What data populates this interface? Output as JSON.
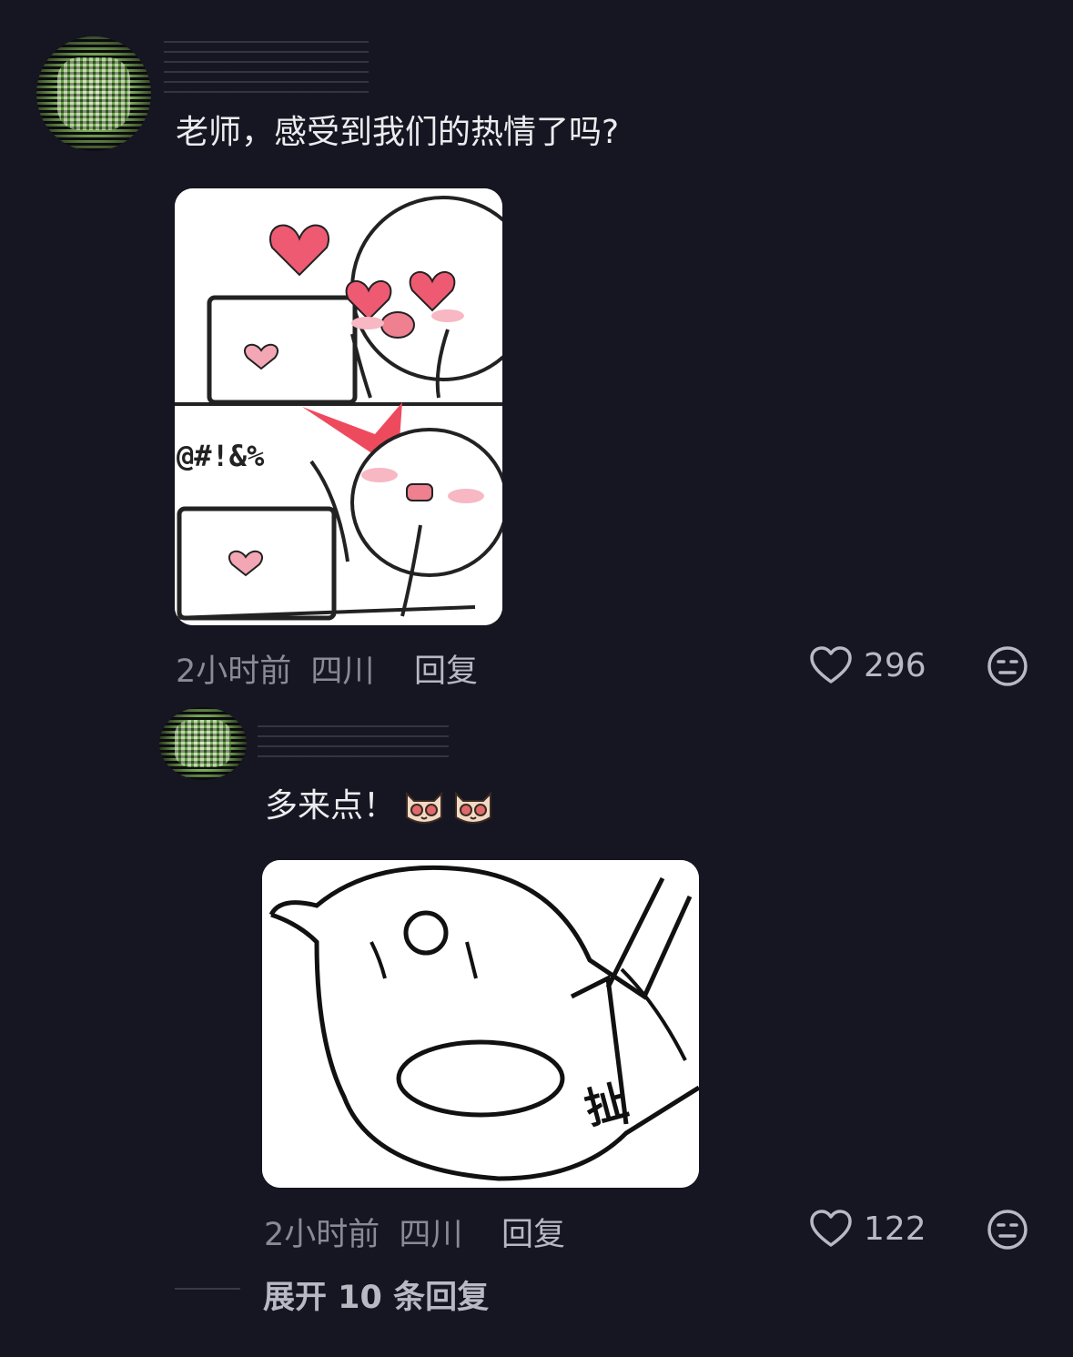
{
  "comments": [
    {
      "text": "老师，感受到我们的热情了吗?",
      "sticker_icon": "heart-eyes-laptop-meme",
      "time": "2小时前",
      "location": "四川",
      "reply_label": "回复",
      "likes": "296",
      "like_icon": "heart-outline-icon",
      "menu_icon": "face-emoji-icon"
    },
    {
      "text": "多来点！",
      "emoji_icons": [
        "cat-dizzy-emoji",
        "cat-dizzy-emoji"
      ],
      "sticker_icon": "cat-pulling-meme",
      "sticker_caption": "扯",
      "time": "2小时前",
      "location": "四川",
      "reply_label": "回复",
      "likes": "122",
      "like_icon": "heart-outline-icon",
      "menu_icon": "face-emoji-icon"
    }
  ],
  "expand": {
    "label": "展开 10 条回复"
  },
  "sticker1": {
    "symbols": "@#!&%"
  }
}
